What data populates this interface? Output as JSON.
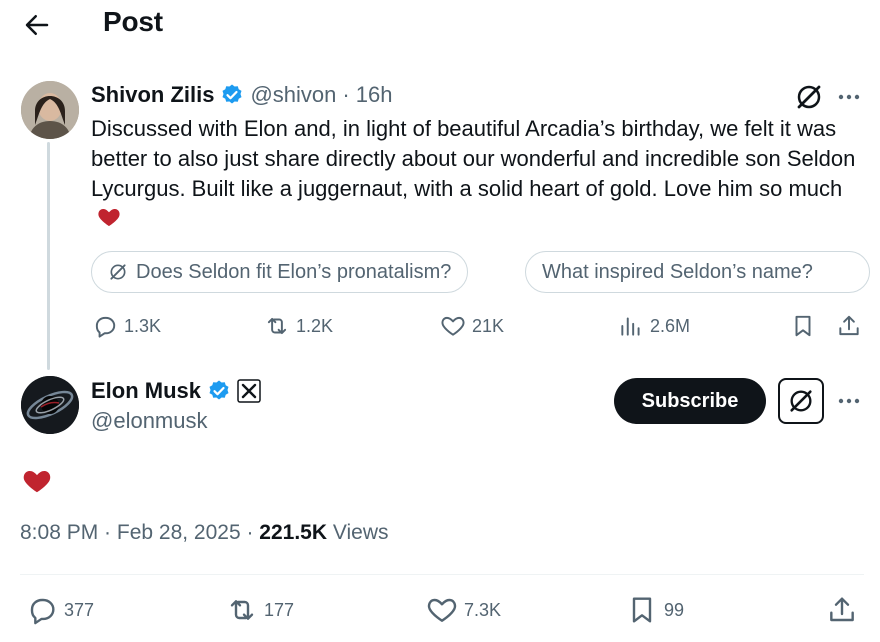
{
  "header": {
    "title": "Post",
    "back_icon": "arrow-left-icon"
  },
  "parent_post": {
    "author_name": "Shivon Zilis",
    "handle": "@shivon",
    "separator": "·",
    "time_ago": "16h",
    "text": "Discussed with Elon and, in light of beautiful Arcadia’s birthday, we felt it was better to also just share directly about our wonderful and incredible son Seldon Lycurgus. Built like a juggernaut, with a solid heart of gold. Love him so much",
    "text_emoji": "red-heart-icon",
    "suggestions": [
      "Does Seldon fit Elon’s pronatalism?",
      "What inspired Seldon’s name?"
    ],
    "stats": {
      "replies": "1.3K",
      "reposts": "1.2K",
      "likes": "21K",
      "views": "2.6M"
    }
  },
  "main_post": {
    "author_name": "Elon Musk",
    "handle": "@elonmusk",
    "subscribe_label": "Subscribe",
    "content_emoji": "red-heart-icon",
    "date_time": "8:08 PM · Feb 28, 2025 · ",
    "views_count": "221.5K",
    "views_label": " Views",
    "stats": {
      "replies": "377",
      "reposts": "177",
      "likes": "7.3K",
      "bookmarks": "99"
    }
  },
  "colors": {
    "text_primary": "#0f1419",
    "text_secondary": "#536471",
    "verified_blue": "#1d9bf0",
    "heart_red": "#c0242f",
    "border": "#cfd9de"
  }
}
